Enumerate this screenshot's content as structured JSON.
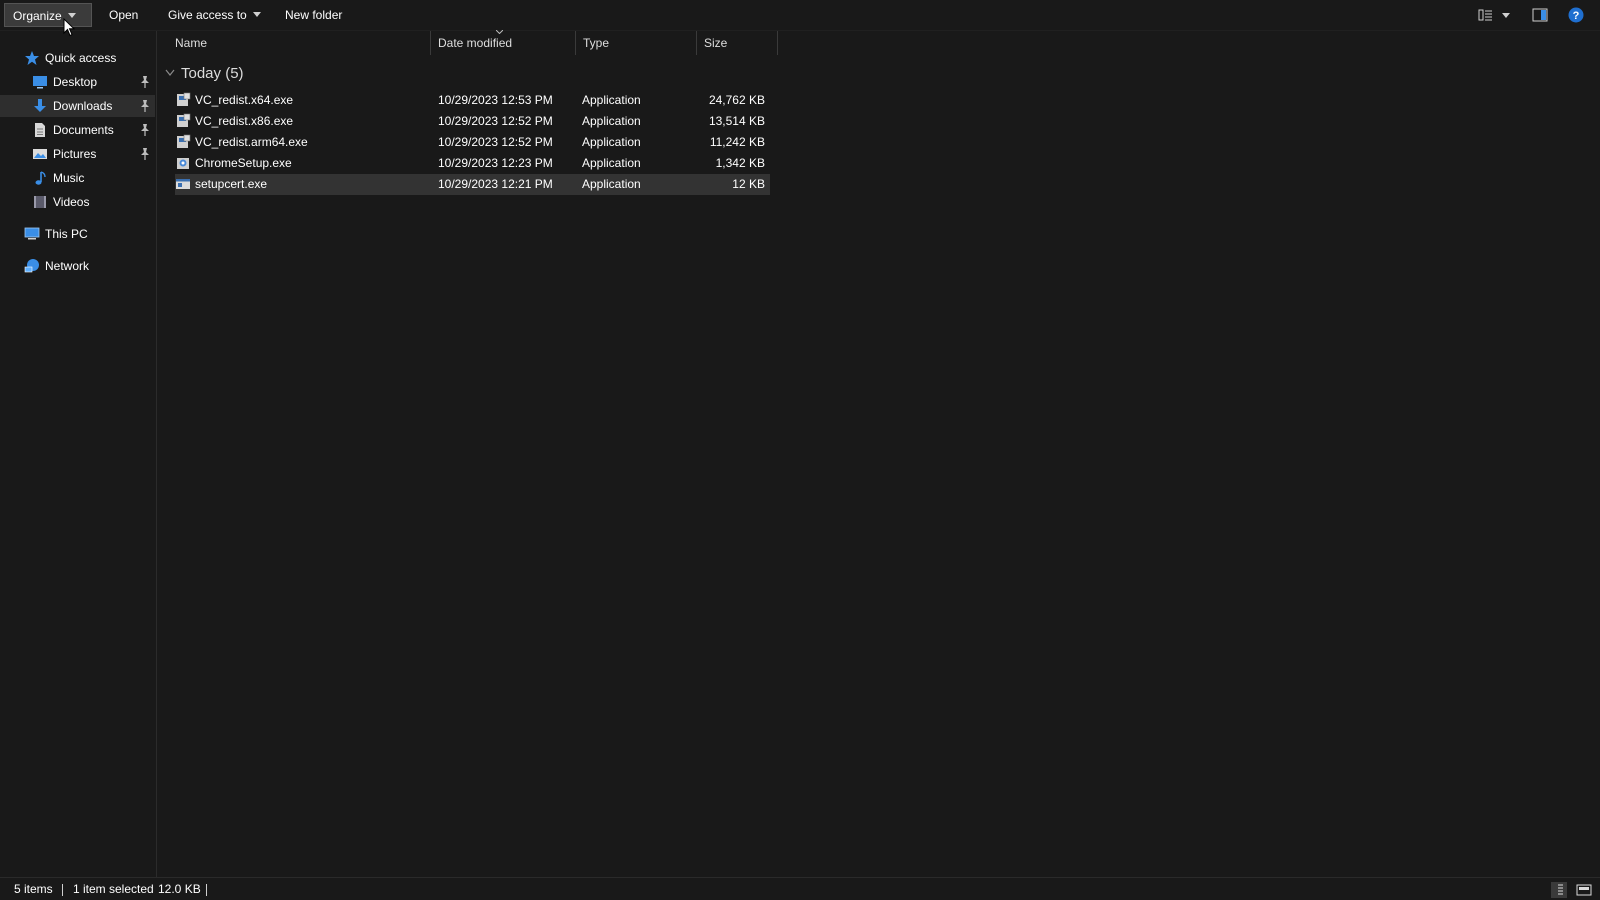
{
  "toolbar": {
    "organize_label": "Organize",
    "open_label": "Open",
    "give_access_label": "Give access to",
    "new_folder_label": "New folder",
    "right_icons": [
      "view-options-icon",
      "preview-pane-icon",
      "help-icon"
    ]
  },
  "nav": {
    "quick_access": "Quick access",
    "items": [
      {
        "label": "Desktop",
        "icon": "desktop-icon",
        "pinned": true
      },
      {
        "label": "Downloads",
        "icon": "downloads-icon",
        "pinned": true,
        "selected": true
      },
      {
        "label": "Documents",
        "icon": "documents-icon",
        "pinned": true
      },
      {
        "label": "Pictures",
        "icon": "pictures-icon",
        "pinned": true
      },
      {
        "label": "Music",
        "icon": "music-icon",
        "pinned": false
      },
      {
        "label": "Videos",
        "icon": "videos-icon",
        "pinned": false
      }
    ],
    "this_pc": "This PC",
    "network": "Network"
  },
  "columns": {
    "name": "Name",
    "date_modified": "Date modified",
    "type": "Type",
    "size": "Size"
  },
  "group": {
    "label": "Today (5)"
  },
  "files": [
    {
      "name": "VC_redist.x64.exe",
      "date": "10/29/2023 12:53 PM",
      "type": "Application",
      "size": "24,762 KB",
      "icon": "installer-icon"
    },
    {
      "name": "VC_redist.x86.exe",
      "date": "10/29/2023 12:52 PM",
      "type": "Application",
      "size": "13,514 KB",
      "icon": "installer-icon"
    },
    {
      "name": "VC_redist.arm64.exe",
      "date": "10/29/2023 12:52 PM",
      "type": "Application",
      "size": "11,242 KB",
      "icon": "installer-icon"
    },
    {
      "name": "ChromeSetup.exe",
      "date": "10/29/2023 12:23 PM",
      "type": "Application",
      "size": "1,342 KB",
      "icon": "setup-icon"
    },
    {
      "name": "setupcert.exe",
      "date": "10/29/2023 12:21 PM",
      "type": "Application",
      "size": "12 KB",
      "icon": "app-window-icon",
      "selected": true
    }
  ],
  "status": {
    "item_count": "5 items",
    "selection": "1 item selected",
    "selection_size": "12.0 KB"
  },
  "colors": {
    "background": "#191919",
    "selected_row": "#333333",
    "accent_blue": "#3a8ee6"
  }
}
